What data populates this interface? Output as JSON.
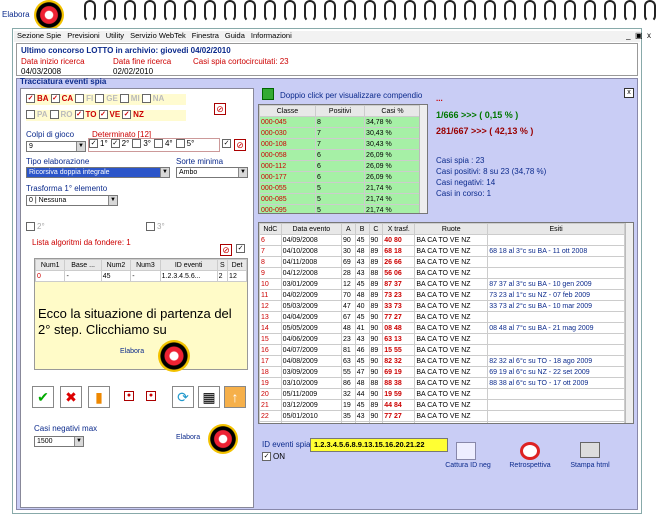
{
  "app": {
    "title": "Elabora"
  },
  "menu": [
    "Sezione Spie",
    "Previsioni",
    "Utility",
    "Servizio WebTek",
    "Finestra",
    "Guida",
    "Informazioni"
  ],
  "window_controls": [
    "_",
    "▣",
    "x"
  ],
  "last_draw": {
    "label": "Ultimo concorso LOTTO in archivio: giovedi 04/02/2010",
    "start_label": "Data inizio ricerca",
    "start_value": "04/03/2008",
    "end_label": "Data fine ricerca",
    "end_value": "02/02/2010",
    "shorted_label": "Casi spia cortocircuitati: 23"
  },
  "section_title": "Tracciatura eventi spia",
  "wheels": [
    {
      "name": "BA",
      "on": true
    },
    {
      "name": "CA",
      "on": true
    },
    {
      "name": "FI",
      "on": false
    },
    {
      "name": "GE",
      "on": false
    },
    {
      "name": "MI",
      "on": false
    },
    {
      "name": "NA",
      "on": false
    },
    {
      "name": "PA",
      "on": false
    },
    {
      "name": "RO",
      "on": false
    },
    {
      "name": "TO",
      "on": true
    },
    {
      "name": "VE",
      "on": true
    },
    {
      "name": "NZ",
      "on": true
    }
  ],
  "colpi": {
    "label": "Colpi di gioco",
    "value": "9"
  },
  "determinato": {
    "label": "Determinato [12]",
    "opts": [
      "1°",
      "2°",
      "3°",
      "4°",
      "5°"
    ]
  },
  "tipo": {
    "label": "Tipo elaborazione",
    "value": "Ricorsiva doppia integrale"
  },
  "sorte": {
    "label": "Sorte minima",
    "value": "Ambo"
  },
  "trasforma": {
    "label": "Trasforma 1° elemento",
    "value": "0 | Nessuna"
  },
  "pos": [
    "2°",
    "3°"
  ],
  "alg": {
    "label": "Lista algoritmi da fondere: 1",
    "headers": [
      "Num1",
      "Base ...",
      "Num2",
      "Num3",
      "ID eventi",
      "S",
      "Det"
    ],
    "row": [
      "0",
      "-",
      "45",
      "-",
      "1.2.3.4.5.6...",
      "2",
      "12"
    ]
  },
  "overlay": "Ecco la situazione di partenza del 2° step. Clicchiamo su",
  "elabora_label": "Elabora",
  "casi_neg": {
    "label": "Casi negativi max",
    "value": "1500"
  },
  "classe_hint": "Doppio click per visualizzare compendio",
  "classe": {
    "headers": [
      "Classe",
      "Positivi",
      "Casi %"
    ],
    "rows": [
      [
        "000-045",
        "8",
        "34,78 %"
      ],
      [
        "000-030",
        "7",
        "30,43 %"
      ],
      [
        "000-108",
        "7",
        "30,43 %"
      ],
      [
        "000-058",
        "6",
        "26,09 %"
      ],
      [
        "000-112",
        "6",
        "26,09 %"
      ],
      [
        "000-177",
        "6",
        "26,09 %"
      ],
      [
        "000-055",
        "5",
        "21,74 %"
      ],
      [
        "000-085",
        "5",
        "21,74 %"
      ],
      [
        "000-095",
        "5",
        "21,74 %"
      ],
      [
        "000-100",
        "5",
        "21,74 %"
      ]
    ]
  },
  "stats": {
    "dots": "...",
    "line1": "1/666 >>> ( 0,15 % )",
    "line2": "281/667 >>> ( 42,13 % )",
    "spia": "Casi spia : 23",
    "positivi": "Casi positivi: 8 su 23 (34,78 %)",
    "negativi": "Casi negativi: 14",
    "corso": "Casi in corso: 1"
  },
  "events": {
    "headers": [
      "NdC",
      "Data evento",
      "A",
      "B",
      "C",
      "X trasf.",
      "Ruote",
      "Esiti"
    ],
    "rows": [
      [
        "6",
        "04/09/2008",
        "90",
        "45",
        "90",
        "40 80",
        "BA CA TO VE NZ",
        ""
      ],
      [
        "7",
        "04/10/2008",
        "30",
        "48",
        "89",
        "68 18",
        "BA CA TO VE NZ",
        "68 18 al 3°c su BA - 11 ott 2008"
      ],
      [
        "8",
        "04/11/2008",
        "69",
        "43",
        "89",
        "26 66",
        "BA CA TO VE NZ",
        ""
      ],
      [
        "9",
        "04/12/2008",
        "28",
        "43",
        "88",
        "56 06",
        "BA CA TO VE NZ",
        ""
      ],
      [
        "10",
        "03/01/2009",
        "12",
        "45",
        "89",
        "87 37",
        "BA CA TO VE NZ",
        "87 37 al 3°c su BA - 10 gen 2009"
      ],
      [
        "11",
        "04/02/2009",
        "70",
        "48",
        "89",
        "73 23",
        "BA CA TO VE NZ",
        "73 23 al 1°c su NZ - 07 feb 2009"
      ],
      [
        "12",
        "05/03/2009",
        "47",
        "40",
        "89",
        "33 73",
        "BA CA TO VE NZ",
        "33 73 al 2°c su BA - 10 mar 2009"
      ],
      [
        "13",
        "04/04/2009",
        "67",
        "45",
        "90",
        "77 27",
        "BA CA TO VE NZ",
        ""
      ],
      [
        "14",
        "05/05/2009",
        "48",
        "41",
        "90",
        "08 48",
        "BA CA TO VE NZ",
        "08 48 al 7°c su BA - 21 mag 2009"
      ],
      [
        "15",
        "04/06/2009",
        "23",
        "43",
        "90",
        "63 13",
        "BA CA TO VE NZ",
        ""
      ],
      [
        "16",
        "04/07/2009",
        "81",
        "46",
        "89",
        "15 55",
        "BA CA TO VE NZ",
        ""
      ],
      [
        "17",
        "04/08/2009",
        "63",
        "45",
        "90",
        "82 32",
        "BA CA TO VE NZ",
        "82 32 al 6°c su TO - 18 ago 2009"
      ],
      [
        "18",
        "03/09/2009",
        "55",
        "47",
        "90",
        "69 19",
        "BA CA TO VE NZ",
        "69 19 al 6°c su NZ - 22 set 2009"
      ],
      [
        "19",
        "03/10/2009",
        "86",
        "48",
        "88",
        "88 38",
        "BA CA TO VE NZ",
        "88 38 al 6°c su TO - 17 ott 2009"
      ],
      [
        "20",
        "05/11/2009",
        "32",
        "44",
        "90",
        "19 59",
        "BA CA TO VE NZ",
        ""
      ],
      [
        "21",
        "03/12/2009",
        "19",
        "45",
        "89",
        "44 84",
        "BA CA TO VE NZ",
        ""
      ],
      [
        "22",
        "05/01/2010",
        "35",
        "43",
        "90",
        "77 27",
        "BA CA TO VE NZ",
        ""
      ],
      [
        "23",
        "04/02/2010 i...",
        "75",
        "48",
        "88",
        "23 63",
        "BA CA TO VE NZ",
        ""
      ]
    ]
  },
  "id_eventi": {
    "label": "ID eventi spia",
    "value": "1.2.3.4.5.6.8.9.13.15.16.20.21.22",
    "on_label": "ON"
  },
  "bottom_buttons": [
    "Cattura ID neg",
    "Retrospettiva",
    "Stampa html"
  ],
  "colors": {
    "accent": "#0b2a8c",
    "panel": "#c9cdf5",
    "green": "#a6f0a6",
    "idbox": "#ffff33"
  }
}
